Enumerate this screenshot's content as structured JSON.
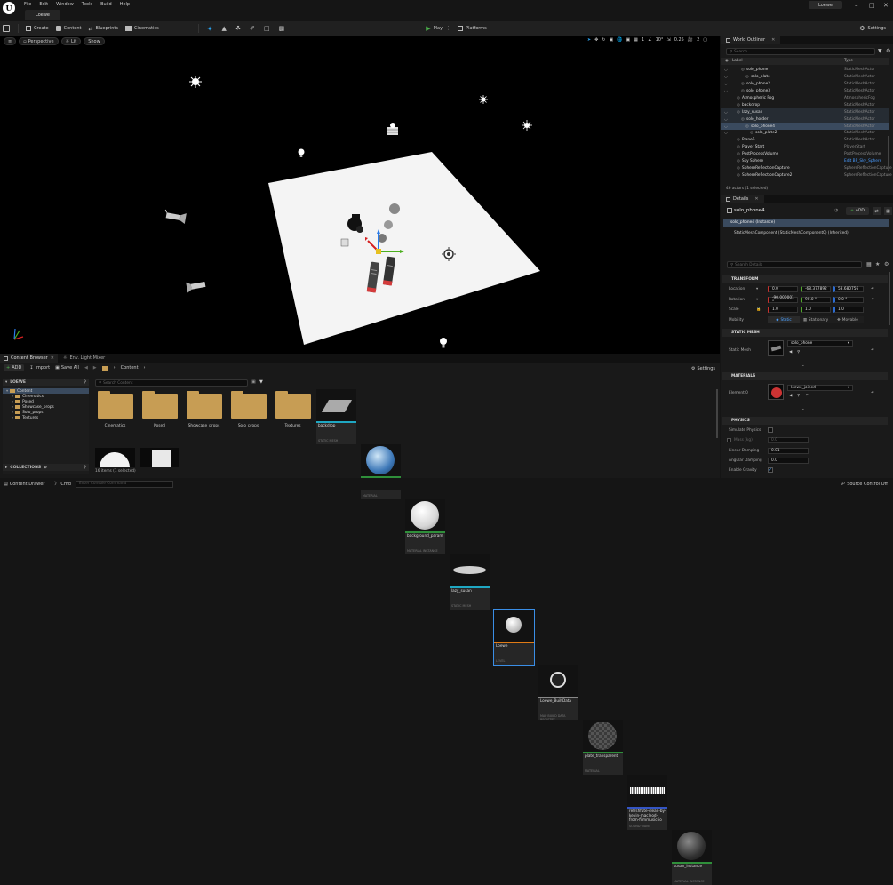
{
  "title_bar": {
    "menu": [
      "File",
      "Edit",
      "Window",
      "Tools",
      "Build",
      "Help"
    ],
    "project_tab": "Loewe",
    "project_name": "Loewe"
  },
  "main_toolbar": {
    "create": "Create",
    "content": "Content",
    "blueprints": "Blueprints",
    "cinematics": "Cinematics",
    "play": "Play",
    "platforms": "Platforms",
    "settings": "Settings"
  },
  "viewport": {
    "perspective": "Perspective",
    "lit": "Lit",
    "show": "Show",
    "rotation_snap": "10°",
    "scale_snap": "0.25",
    "camera_speed": "2",
    "grid_count": "1"
  },
  "outliner": {
    "tab": "World Outliner",
    "search_placeholder": "Search...",
    "col_label": "Label",
    "col_type": "Type",
    "rows": [
      {
        "label": "solo_phone",
        "type": "StaticMeshActor",
        "indent": 2,
        "eye": true
      },
      {
        "label": "solo_plate",
        "type": "StaticMeshActor",
        "indent": 3,
        "eye": true
      },
      {
        "label": "solo_phone2",
        "type": "StaticMeshActor",
        "indent": 2,
        "eye": true
      },
      {
        "label": "solo_phone3",
        "type": "StaticMeshActor",
        "indent": 2,
        "eye": true
      },
      {
        "label": "Atmospheric Fog",
        "type": "AtmosphericFog",
        "indent": 1,
        "eye": false
      },
      {
        "label": "backdrop",
        "type": "StaticMeshActor",
        "indent": 1,
        "eye": false
      },
      {
        "label": "lazy_susan",
        "type": "StaticMeshActor",
        "indent": 1,
        "eye": true,
        "hl": 1
      },
      {
        "label": "solo_holder",
        "type": "StaticMeshActor",
        "indent": 2,
        "eye": true,
        "hl": 1
      },
      {
        "label": "solo_phone4",
        "type": "StaticMeshActor",
        "indent": 3,
        "eye": true,
        "hl": 2
      },
      {
        "label": "solo_plate2",
        "type": "StaticMeshActor",
        "indent": 4,
        "eye": true
      },
      {
        "label": "Plane6",
        "type": "StaticMeshActor",
        "indent": 1,
        "eye": false
      },
      {
        "label": "Player Start",
        "type": "PlayerStart",
        "indent": 1,
        "eye": false
      },
      {
        "label": "PostProcessVolume",
        "type": "PostProcessVolume",
        "indent": 1,
        "eye": false
      },
      {
        "label": "Sky Sphere",
        "type": "Edit BP_Sky_Sphere",
        "indent": 1,
        "eye": false,
        "link": true
      },
      {
        "label": "SphereReflectionCapture",
        "type": "SphereReflectionCapture",
        "indent": 1,
        "eye": false
      },
      {
        "label": "SphereReflectionCapture2",
        "type": "SphereReflectionCapture",
        "indent": 1,
        "eye": false
      }
    ],
    "status": "46 actors (1 selected)"
  },
  "details": {
    "tab": "Details",
    "actor_name": "solo_phone4",
    "add": "ADD",
    "instance": "solo_phone4 (Instance)",
    "component": "StaticMeshComponent (StaticMeshComponent0) (Inherited)",
    "search_placeholder": "Search Details",
    "transform": {
      "header": "TRANSFORM",
      "location_label": "Location",
      "location": [
        "0.0",
        "-68.377892",
        "53.680756"
      ],
      "rotation_label": "Rotation",
      "rotation": [
        "-90.000001 °",
        "90.0 °",
        "0.0 °"
      ],
      "scale_label": "Scale",
      "scale": [
        "1.0",
        "1.0",
        "1.0"
      ],
      "mobility_label": "Mobility",
      "mobility": [
        "Static",
        "Stationary",
        "Movable"
      ]
    },
    "static_mesh": {
      "header": "STATIC MESH",
      "label": "Static Mesh",
      "value": "solo_phone"
    },
    "materials": {
      "header": "MATERIALS",
      "label": "Element 0",
      "value": "loewe_joined"
    },
    "physics": {
      "header": "PHYSICS",
      "simulate": "Simulate Physics",
      "mass": "Mass (kg)",
      "mass_value": "0.0",
      "linear": "Linear Damping",
      "linear_value": "0.01",
      "angular": "Angular Damping",
      "angular_value": "0.0",
      "gravity": "Enable Gravity"
    }
  },
  "content_browser": {
    "tab1": "Content Browser",
    "tab2": "Env. Light Mixer",
    "add": "ADD",
    "import": "Import",
    "save_all": "Save All",
    "path": "Content",
    "settings": "Settings",
    "tree_root": "LOEWE",
    "tree": [
      {
        "name": "Content",
        "level": 0,
        "sel": true
      },
      {
        "name": "Cinematics",
        "level": 1
      },
      {
        "name": "Posed",
        "level": 1
      },
      {
        "name": "Showcase_props",
        "level": 1
      },
      {
        "name": "Solo_props",
        "level": 1
      },
      {
        "name": "Textures",
        "level": 1
      }
    ],
    "collections": "COLLECTIONS",
    "search_placeholder": "Search Content",
    "folders": [
      "Cinematics",
      "Posed",
      "Showcase_props",
      "Solo_props",
      "Textures"
    ],
    "assets": [
      {
        "name": "backdrop",
        "type": "STATIC MESH",
        "color": "#1fa7c2"
      },
      {
        "name": "background",
        "type": "MATERIAL",
        "color": "#2f8f3a"
      },
      {
        "name": "background_param",
        "type": "MATERIAL INSTANCE",
        "color": "#2f8f3a"
      },
      {
        "name": "lazy_susan",
        "type": "STATIC MESH",
        "color": "#1fa7c2"
      },
      {
        "name": "Loewe",
        "type": "LEVEL",
        "color": "#e07b16"
      },
      {
        "name": "Loewe_BuiltData",
        "type": "MAP BUILD DATA REGISTRY",
        "color": "#888888"
      },
      {
        "name": "plate_transparent",
        "type": "MATERIAL",
        "color": "#2f8f3a"
      },
      {
        "name": "refrshfute-clean-by-kevin-macleod-from-filmmusic-io",
        "type": "SOUND WAVE",
        "color": "#3455c4"
      },
      {
        "name": "susan_instance",
        "type": "MATERIAL INSTANCE",
        "color": "#2f8f3a"
      }
    ],
    "count": "16 items (1 selected)"
  },
  "status_bar": {
    "content_drawer": "Content Drawer",
    "cmd": "Cmd",
    "console_placeholder": "Enter Console Command",
    "source_control": "Source Control Off"
  }
}
